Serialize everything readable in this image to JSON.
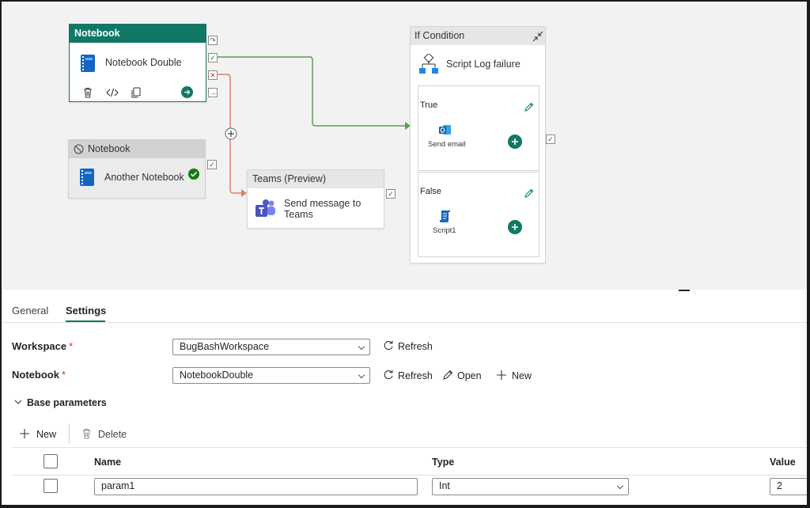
{
  "canvas": {
    "notebook1": {
      "header": "Notebook",
      "name": "Notebook Double"
    },
    "notebook2": {
      "header": "Notebook",
      "name": "Another Notebook"
    },
    "teams": {
      "header": "Teams (Preview)",
      "name": "Send message to Teams"
    },
    "if_condition": {
      "header": "If Condition",
      "name": "Script Log failure",
      "true_branch": {
        "label": "True",
        "activity": "Send email"
      },
      "false_branch": {
        "label": "False",
        "activity": "Script1"
      }
    }
  },
  "tabs": [
    {
      "label": "General",
      "active": false
    },
    {
      "label": "Settings",
      "active": true
    }
  ],
  "settings": {
    "workspace": {
      "label": "Workspace",
      "required_mark": "*",
      "value": "BugBashWorkspace",
      "refresh": "Refresh"
    },
    "notebook": {
      "label": "Notebook",
      "required_mark": "*",
      "value": "NotebookDouble",
      "refresh": "Refresh",
      "open": "Open",
      "new": "New"
    }
  },
  "base_parameters": {
    "title": "Base parameters",
    "new": "New",
    "delete": "Delete",
    "columns": [
      "Name",
      "Type",
      "Value"
    ],
    "rows": [
      {
        "name": "param1",
        "type": "Int",
        "value": "2"
      }
    ]
  },
  "colors": {
    "accent": "#117865",
    "success": "#107c10",
    "error": "#c4314b",
    "failure_wire": "#d9826b",
    "teams": "#5059c9"
  }
}
